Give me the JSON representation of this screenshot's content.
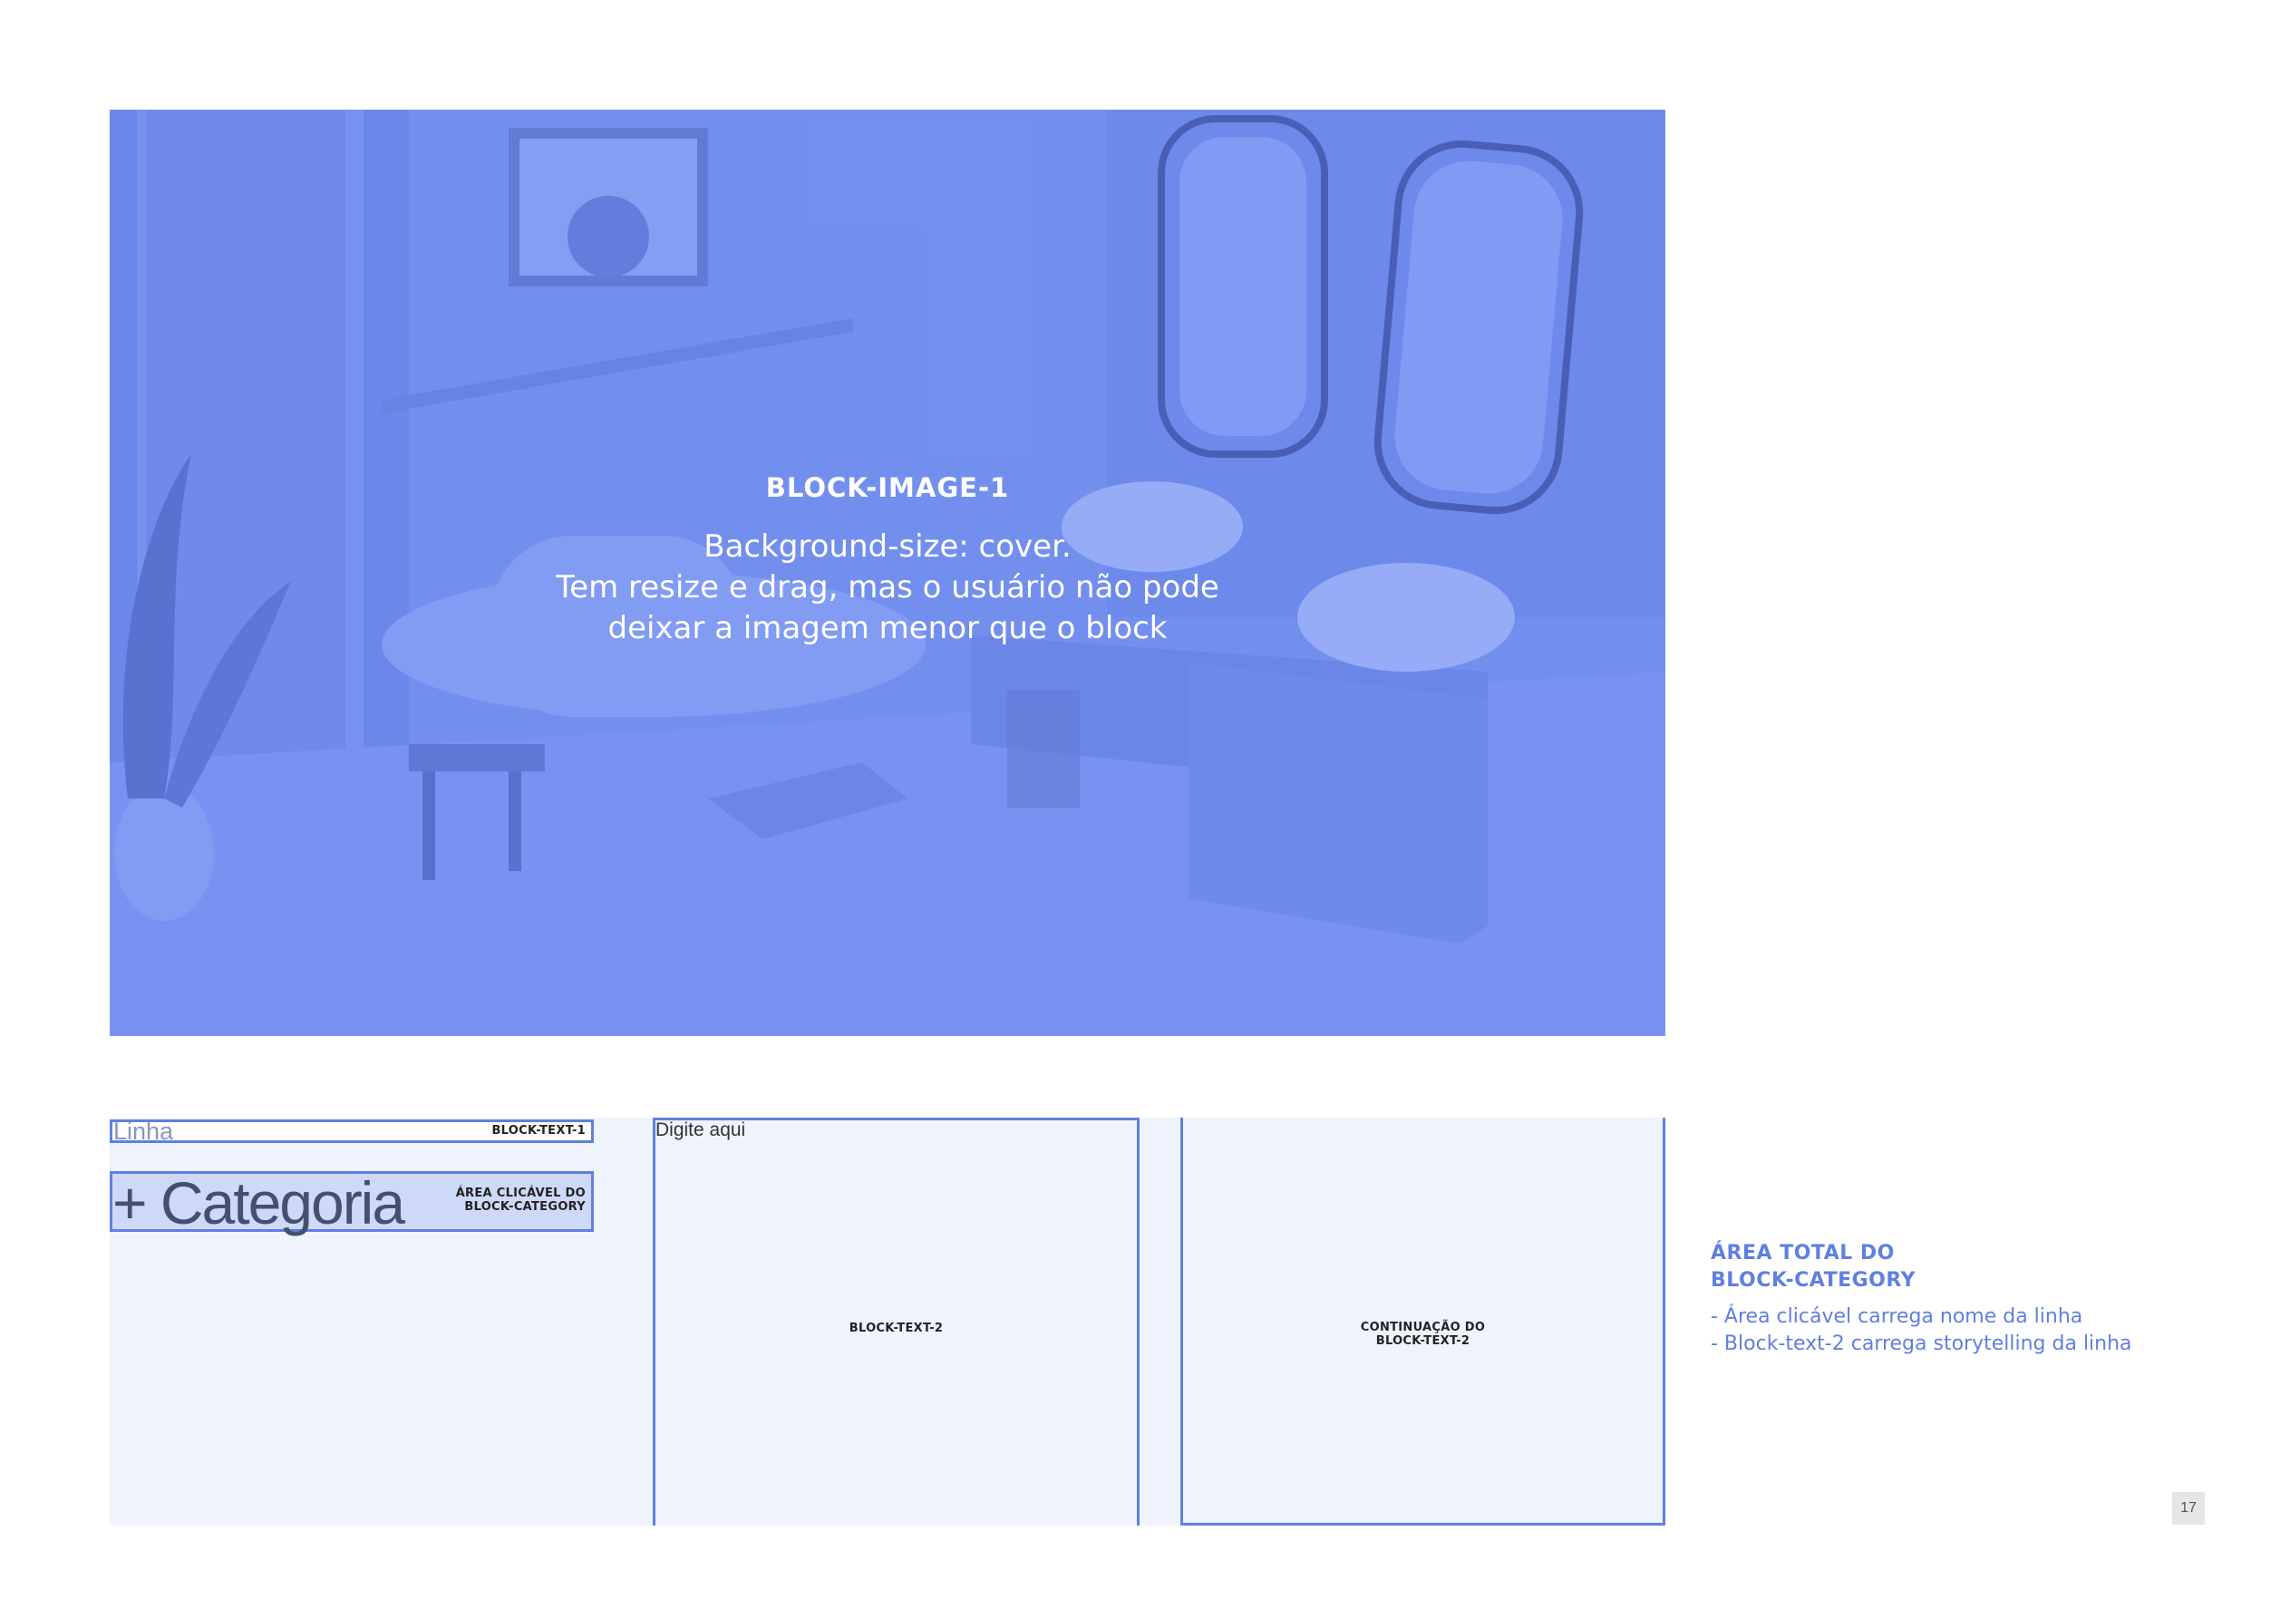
{
  "hero": {
    "title": "BLOCK-IMAGE-1",
    "description": [
      "Background-size: cover.",
      "Tem resize e drag, mas o usuário não pode",
      "deixar a imagem menor que o block"
    ],
    "overlay_color": "#7189ea"
  },
  "block_text_1": {
    "value": "Linha",
    "label": "BLOCK-TEXT-1"
  },
  "category": {
    "value": "+ Categoria",
    "label_line1": "ÁREA CLICÁVEL DO",
    "label_line2": "BLOCK-CATEGORY"
  },
  "block_text_2": {
    "placeholder": "Digite aqui",
    "label": "BLOCK-TEXT-2"
  },
  "block_text_2_cont": {
    "label_line1": "CONTINUAÇÃO DO",
    "label_line2": "BLOCK-TEXT-2"
  },
  "notes": {
    "title_line1": "ÁREA TOTAL DO",
    "title_line2": "BLOCK-CATEGORY",
    "items": [
      "- Área clicável carrega nome da linha",
      "- Block-text-2 carrega storytelling da linha"
    ]
  },
  "page_number": "17",
  "colors": {
    "accent": "#5f7fe1",
    "area_bg": "#eef3fc",
    "clickable_bg": "#ced9f8"
  }
}
